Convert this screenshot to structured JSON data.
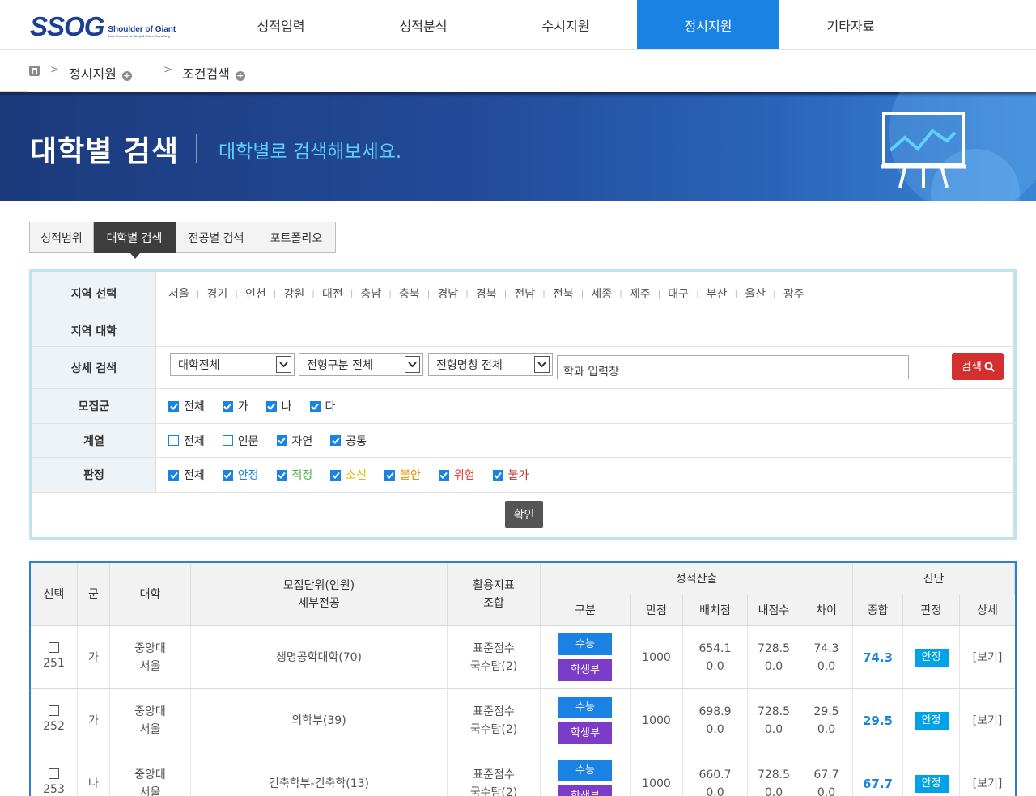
{
  "logo": {
    "main": "SSOG",
    "sub": "Shoulder of Giant",
    "tag": "1to1 Customized Study & Exam Consulting"
  },
  "nav": [
    "성적입력",
    "성적분석",
    "수시지원",
    "정시지원",
    "기타자료"
  ],
  "breadcrumb": {
    "level1": "정시지원",
    "level2": "조건검색",
    "separator": ">"
  },
  "hero": {
    "title": "대학별 검색",
    "subtitle": "대학별로 검색해보세요."
  },
  "tabs": [
    "성적범위",
    "대학별 검색",
    "전공별 검색",
    "포트폴리오"
  ],
  "filter": {
    "region_label": "지역 선택",
    "regions": [
      "서울",
      "경기",
      "인천",
      "강원",
      "대전",
      "충남",
      "충북",
      "경남",
      "경북",
      "전남",
      "전북",
      "세종",
      "제주",
      "대구",
      "부산",
      "울산",
      "광주"
    ],
    "region_uni_label": "지역 대학",
    "detail_label": "상세 검색",
    "select_univ": "대학전체",
    "select_type": "전형구분 전체",
    "select_name": "전형명칭 전체",
    "dept_input": "학과 입력창",
    "search_btn": "검색",
    "group_label": "모집군",
    "groups": [
      {
        "t": "전체",
        "on": true
      },
      {
        "t": "가",
        "on": true
      },
      {
        "t": "나",
        "on": true
      },
      {
        "t": "다",
        "on": true
      }
    ],
    "field_label": "계열",
    "fields": [
      {
        "t": "전체",
        "on": false
      },
      {
        "t": "인문",
        "on": false
      },
      {
        "t": "자연",
        "on": true
      },
      {
        "t": "공통",
        "on": true
      }
    ],
    "judge_label": "판정",
    "judges": [
      {
        "t": "전체",
        "on": true,
        "color": "#333333"
      },
      {
        "t": "안정",
        "on": true,
        "color": "#1a82e2"
      },
      {
        "t": "적정",
        "on": true,
        "color": "#4caf50"
      },
      {
        "t": "소신",
        "on": true,
        "color": "#e6b800"
      },
      {
        "t": "불안",
        "on": true,
        "color": "#f08c00"
      },
      {
        "t": "위험",
        "on": true,
        "color": "#e53935"
      },
      {
        "t": "불가",
        "on": true,
        "color": "#c62828"
      }
    ],
    "confirm_btn": "확인"
  },
  "table": {
    "headers": {
      "select": "선택",
      "group": "군",
      "univ": "대학",
      "unit": "모집단위(인원)",
      "unit2": "세부전공",
      "index": "활용지표",
      "index2": "조합",
      "calc": "성적산출",
      "diag": "진단",
      "kind": "구분",
      "full": "만점",
      "cut": "배치점",
      "mine": "내점수",
      "diff": "차이",
      "sum": "종합",
      "judge": "판정",
      "detail": "상세"
    },
    "rows": [
      {
        "no": "251",
        "group": "가",
        "univ": "중앙대",
        "loc": "서울",
        "unit": "생명공학대학(70)",
        "idx1": "표준점수",
        "idx2": "국수탐(2)",
        "tag1": "수능",
        "tag2": "학생부",
        "full": "1000",
        "cut1": "654.1",
        "cut2": "0.0",
        "mine1": "728.5",
        "mine2": "0.0",
        "diff1": "74.3",
        "diff2": "0.0",
        "sum": "74.3",
        "judge": "안정",
        "view": "[보기]"
      },
      {
        "no": "252",
        "group": "가",
        "univ": "중앙대",
        "loc": "서울",
        "unit": "의학부(39)",
        "idx1": "표준점수",
        "idx2": "국수탐(2)",
        "tag1": "수능",
        "tag2": "학생부",
        "full": "1000",
        "cut1": "698.9",
        "cut2": "0.0",
        "mine1": "728.5",
        "mine2": "0.0",
        "diff1": "29.5",
        "diff2": "0.0",
        "sum": "29.5",
        "judge": "안정",
        "view": "[보기]"
      },
      {
        "no": "253",
        "group": "나",
        "univ": "중앙대",
        "loc": "서울",
        "unit": "건축학부-건축학(13)",
        "idx1": "표준점수",
        "idx2": "국수탐(2)",
        "tag1": "수능",
        "tag2": "학생부",
        "full": "1000",
        "cut1": "660.7",
        "cut2": "0.0",
        "mine1": "728.5",
        "mine2": "0.0",
        "diff1": "67.7",
        "diff2": "0.0",
        "sum": "67.7",
        "judge": "안정",
        "view": "[보기]"
      }
    ]
  }
}
